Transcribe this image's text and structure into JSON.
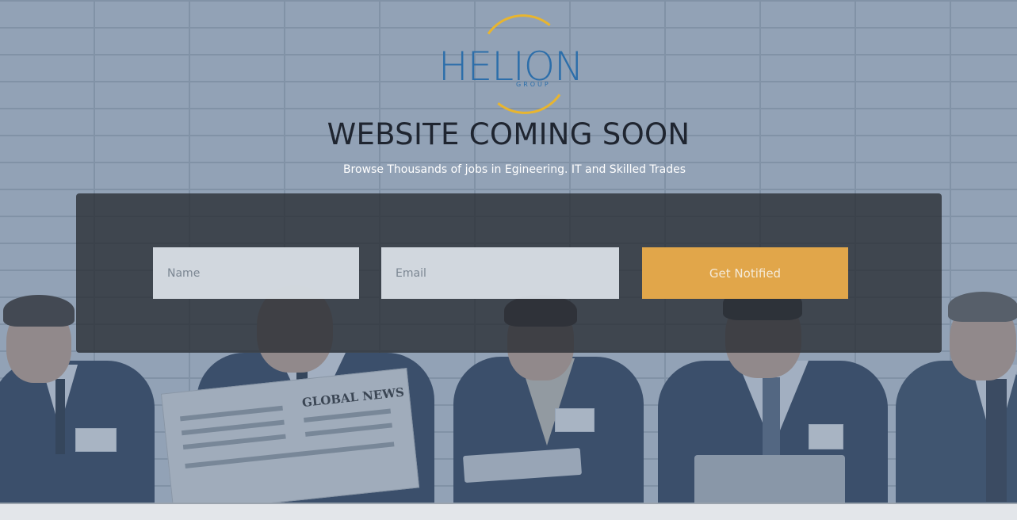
{
  "logo": {
    "word": "HELION",
    "sub": "GROUP"
  },
  "hero": {
    "title": "WEBSITE COMING SOON",
    "subtitle": "Browse Thousands of jobs in Egineering. IT and Skilled Trades"
  },
  "form": {
    "name_placeholder": "Name",
    "email_placeholder": "Email",
    "submit_label": "Get Notified"
  },
  "photo": {
    "newspaper_headline": "GLOBAL NEWS"
  },
  "colors": {
    "accent": "#e1a64a",
    "logo_blue": "#2c6eaa",
    "logo_gold": "#e8b52f",
    "panel": "#282c32"
  }
}
